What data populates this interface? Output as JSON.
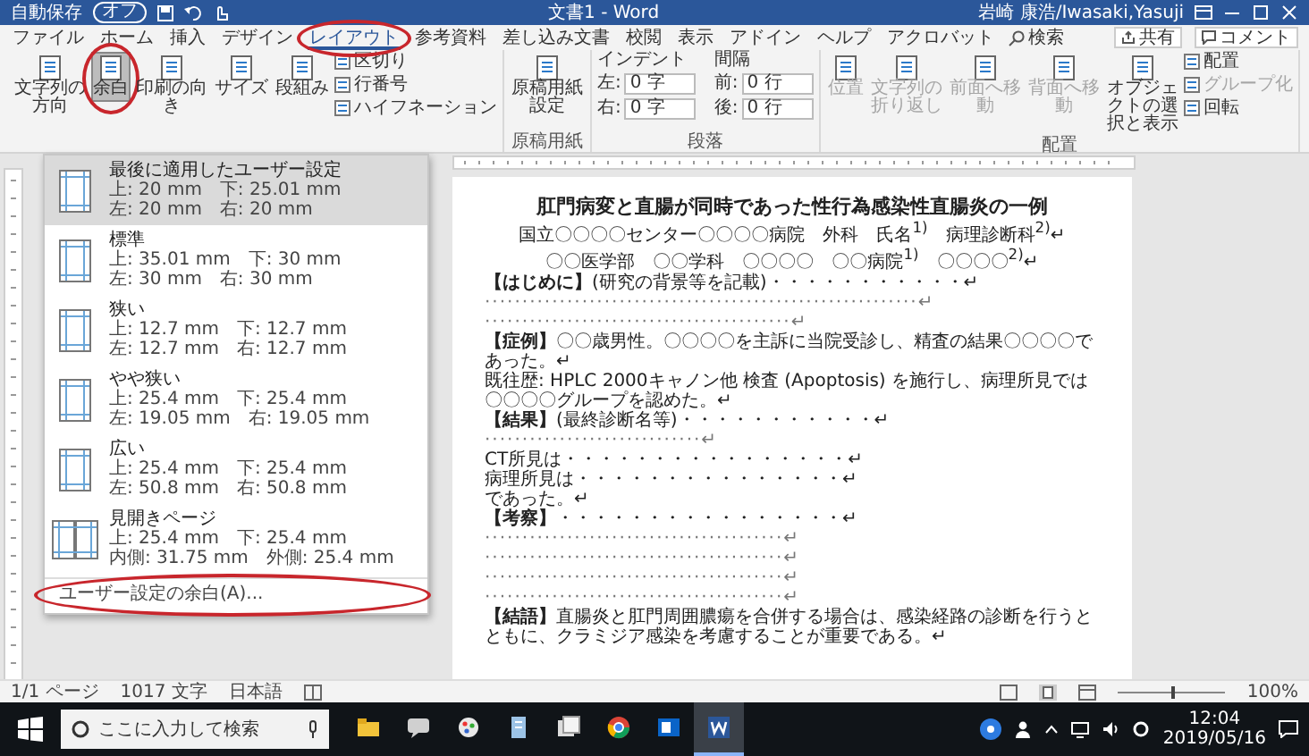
{
  "title_bar": {
    "autosave": {
      "label": "自動保存",
      "state_text": "オフ",
      "on": false
    },
    "title": "文書1 - Word",
    "user": "岩崎 康浩/Iwasaki,Yasuji"
  },
  "tabs": [
    {
      "label": "ファイル",
      "selected": false
    },
    {
      "label": "ホーム",
      "selected": false
    },
    {
      "label": "挿入",
      "selected": false
    },
    {
      "label": "デザイン",
      "selected": false
    },
    {
      "label": "レイアウト",
      "selected": true,
      "ringed": true
    },
    {
      "label": "参考資料",
      "selected": false
    },
    {
      "label": "差し込み文書",
      "selected": false
    },
    {
      "label": "校閲",
      "selected": false
    },
    {
      "label": "表示",
      "selected": false
    },
    {
      "label": "アドイン",
      "selected": false
    },
    {
      "label": "ヘルプ",
      "selected": false
    },
    {
      "label": "アクロバット",
      "selected": false
    }
  ],
  "search": {
    "label": "検索"
  },
  "share": "共有",
  "comments": "コメント",
  "ribbon": {
    "groups": [
      {
        "kind": "buttons",
        "buttons": [
          {
            "label": "文字列の方向",
            "kind": "large",
            "active": false,
            "disabled": false
          },
          {
            "label": "余白",
            "kind": "large",
            "active": true,
            "disabled": false,
            "ringed": true
          },
          {
            "label": "印刷の向き",
            "kind": "large",
            "active": false,
            "disabled": false
          },
          {
            "label": "サイズ",
            "kind": "large",
            "active": false,
            "disabled": false
          },
          {
            "label": "段組み",
            "kind": "large",
            "active": false,
            "disabled": false
          },
          {
            "label": "区切り",
            "kind": "small",
            "disabled": false
          },
          {
            "label": "行番号",
            "kind": "small",
            "disabled": false
          },
          {
            "label": "ハイフネーション",
            "kind": "small",
            "disabled": false
          }
        ]
      },
      {
        "kind": "buttons",
        "label": "原稿用紙",
        "buttons": [
          {
            "label": "原稿用紙設定",
            "kind": "large",
            "active": false,
            "disabled": false
          }
        ]
      },
      {
        "kind": "paragraph",
        "label": "段落",
        "columns": [
          {
            "label": "インデント",
            "fields": [
              {
                "label": "左:",
                "value": "0 字"
              },
              {
                "label": "右:",
                "value": "0 字"
              }
            ]
          },
          {
            "label": "間隔",
            "fields": [
              {
                "label": "前:",
                "value": "0 行"
              },
              {
                "label": "後:",
                "value": "0 行"
              }
            ]
          }
        ]
      },
      {
        "kind": "buttons",
        "label": "配置",
        "buttons": [
          {
            "label": "位置",
            "kind": "large",
            "active": false,
            "disabled": true
          },
          {
            "label": "文字列の折り返し",
            "kind": "large",
            "active": false,
            "disabled": true
          },
          {
            "label": "前面へ移動",
            "kind": "large",
            "active": false,
            "disabled": true
          },
          {
            "label": "背面へ移動",
            "kind": "large",
            "active": false,
            "disabled": true
          },
          {
            "label": "オブジェクトの選択と表示",
            "kind": "large",
            "active": false,
            "disabled": false
          },
          {
            "label": "配置",
            "kind": "small",
            "disabled": false
          },
          {
            "label": "グループ化",
            "kind": "small",
            "disabled": true
          },
          {
            "label": "回転",
            "kind": "small",
            "disabled": false
          }
        ]
      }
    ]
  },
  "margins_menu": {
    "items": [
      {
        "title": "最後に適用したユーザー設定",
        "line_1": "上: 20 mm　下: 25.01 mm",
        "line_2": "左: 20 mm　右: 20 mm",
        "kind": "single",
        "selected": true
      },
      {
        "title": "標準",
        "line_1": "上: 35.01 mm　下: 30 mm",
        "line_2": "左: 30 mm　右: 30 mm",
        "kind": "single",
        "selected": false
      },
      {
        "title": "狭い",
        "line_1": "上: 12.7 mm　下: 12.7 mm",
        "line_2": "左: 12.7 mm　右: 12.7 mm",
        "kind": "single",
        "selected": false
      },
      {
        "title": "やや狭い",
        "line_1": "上: 25.4 mm　下: 25.4 mm",
        "line_2": "左: 19.05 mm　右: 19.05 mm",
        "kind": "single",
        "selected": false
      },
      {
        "title": "広い",
        "line_1": "上: 25.4 mm　下: 25.4 mm",
        "line_2": "左: 50.8 mm　右: 50.8 mm",
        "kind": "single",
        "selected": false
      },
      {
        "title": "見開きページ",
        "line_1": "上: 25.4 mm　下: 25.4 mm",
        "line_2": "内側: 31.75 mm　外側: 25.4 mm",
        "kind": "facing",
        "selected": false
      }
    ],
    "footer": {
      "label": "ユーザー設定の余白(A)...",
      "ringed": true
    }
  },
  "document": {
    "paragraphs": [
      {
        "kind": "title",
        "text": "肛門病変と直腸が同時であった性行為感染性直腸炎の一例"
      },
      {
        "kind": "author",
        "text": "国立〇〇〇〇センター〇〇〇〇病院　外科　氏名$^{1)}$　病理診断科$^{2)}$↵"
      },
      {
        "kind": "author",
        "text": "〇〇医学部　〇〇学科　〇〇〇〇　〇〇病院$^{1)}$　〇〇〇〇$^{2)}$↵"
      },
      {
        "kind": "body",
        "text": "**【はじめに】**(研究の背景等を記載)・・・・・・・・・・・↵"
      },
      {
        "kind": "dots",
        "text": "··························································↵"
      },
      {
        "kind": "dots",
        "text": "·········································↵"
      },
      {
        "kind": "body",
        "text": "**【症例】**〇〇歳男性。〇〇〇〇を主訴に当院受診し、精査の結果〇〇〇〇であった。↵"
      },
      {
        "kind": "body",
        "text": "既往歴: HPLC 2000キャノン他 検査 (Apoptosis) を施行し、病理所見では〇〇〇〇グループを認めた。↵"
      },
      {
        "kind": "body",
        "text": "**【結果】**(最終診断名等)・・・・・・・・・・・↵"
      },
      {
        "kind": "dots",
        "text": "·····························↵"
      },
      {
        "kind": "body",
        "text": "CT所見は・・・・・・・・・・・・・・・・↵"
      },
      {
        "kind": "body",
        "text": "病理所見は・・・・・・・・・・・・・・・↵"
      },
      {
        "kind": "body",
        "text": "であった。↵"
      },
      {
        "kind": "body",
        "text": "**【考察】**・・・・・・・・・・・・・・・・↵"
      },
      {
        "kind": "dots",
        "text": "········································↵"
      },
      {
        "kind": "dots",
        "text": "········································↵"
      },
      {
        "kind": "dots",
        "text": "········································↵"
      },
      {
        "kind": "dots",
        "text": "········································↵"
      },
      {
        "kind": "body",
        "text": "**【結語】**直腸炎と肛門周囲膿瘍を合併する場合は、感染経路の診断を行うとともに、クラミジア感染を考慮することが重要である。↵"
      }
    ]
  },
  "status_bar": {
    "page": "1/1 ページ",
    "words": "1017 文字",
    "language": "日本語",
    "zoom": {
      "level": 0.5,
      "reading": "100%"
    }
  },
  "taskbar": {
    "search_placeholder": "ここに入力して検索",
    "apps": [
      {
        "kind": "folder",
        "selected": false
      },
      {
        "kind": "chat",
        "selected": false
      },
      {
        "kind": "paint",
        "selected": false
      },
      {
        "kind": "note",
        "selected": false
      },
      {
        "kind": "files",
        "selected": false
      },
      {
        "kind": "browser",
        "selected": false
      },
      {
        "kind": "mail",
        "selected": false
      },
      {
        "kind": "word",
        "selected": true
      }
    ],
    "time": "12:04",
    "date": "2019/05/16"
  }
}
